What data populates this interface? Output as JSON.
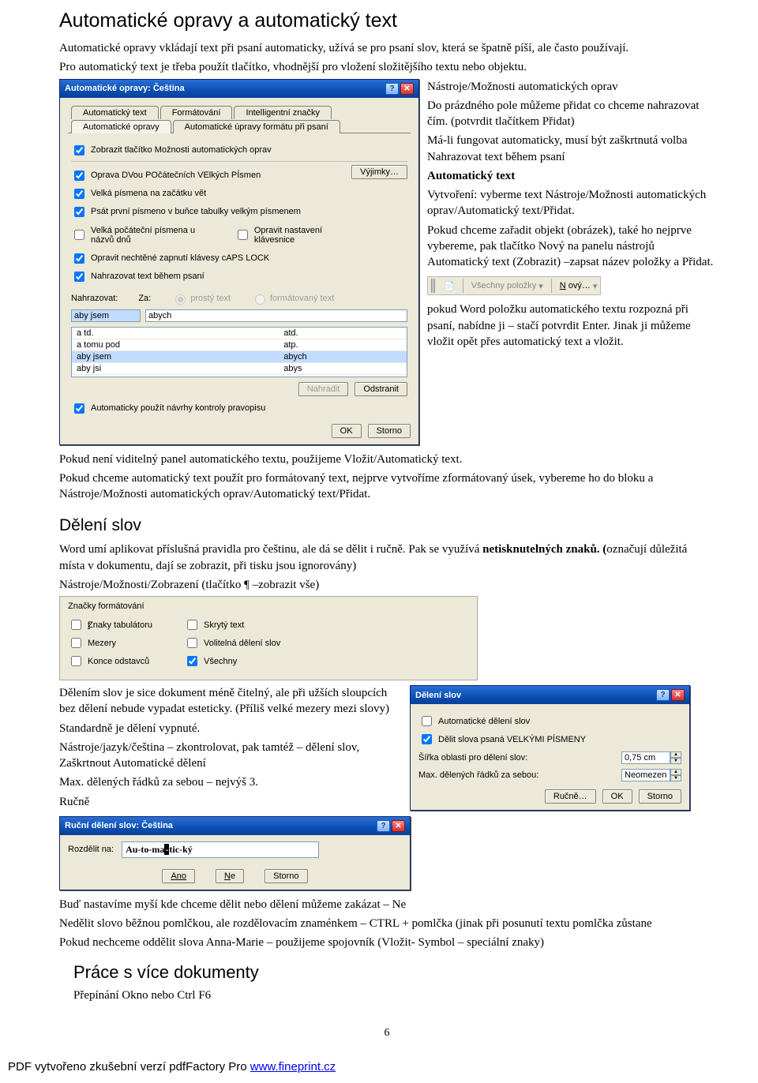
{
  "h1": "Automatické opravy a automatický text",
  "intro1": "Automatické opravy vkládají text při psaní automaticky, užívá se pro psaní slov, která se špatně píší, ale často používají.",
  "intro2": "Pro automatický text je třeba použít tlačítko, vhodnější pro vložení složitějšího textu nebo objektu.",
  "dlg1": {
    "title": "Automatické opravy: Čeština",
    "tabs": [
      "Automatický text",
      "Formátování",
      "Intelligentní značky",
      "Automatické opravy",
      "Automatické úpravy formátu při psaní"
    ],
    "chk_top": "Zobrazit tlačítko Možnosti automatických oprav",
    "opts": [
      "Oprava DVou POčátečních VElkých PÍsmen",
      "Velká písmena na začátku vět",
      "Psát první písmeno v buňce tabulky velkým písmenem",
      "Velká počáteční písmena u názvů dnů",
      "Opravit nastavení klávesnice",
      "Opravit nechtěné zapnutí klávesy cAPS LOCK",
      "Nahrazovat text během psaní"
    ],
    "opt_checked": [
      true,
      true,
      true,
      false,
      false,
      true,
      true
    ],
    "btn_exc": "Výjimky…",
    "lbl_nahr": "Nahrazovat:",
    "lbl_za": "Za:",
    "radio1": "prostý text",
    "radio2": "formátovaný text",
    "in1": "aby jsem",
    "in2": "abych",
    "rows": [
      [
        "a td.",
        "atd."
      ],
      [
        "a tomu pod",
        "atp."
      ],
      [
        "aby jsem",
        "abych"
      ],
      [
        "aby jsi",
        "abys"
      ]
    ],
    "btn_replace": "Nahradit",
    "btn_del": "Odstranit",
    "chk_bottom": "Automaticky použít návrhy kontroly pravopisu",
    "ok": "OK",
    "cancel": "Storno"
  },
  "right_block": {
    "p1": "Nástroje/Možnosti automatických oprav",
    "p2": "Do prázdného pole můžeme přidat co chceme nahrazovat čím. (potvrdit tlačítkem Přidat)",
    "p3": "Má-li fungovat automaticky, musí být zaškrtnutá volba Nahrazovat text během psaní",
    "p4h": "Automatický text",
    "p5": "Vytvoření: vyberme text Nástroje/Možnosti automatických oprav/Automatický text/Přidat.",
    "p6": "Pokud chceme zařadit objekt (obrázek), také ho nejprve vybereme, pak tlačítko Nový na panelu nástrojů Automatický text (Zobrazit) –zapsat název položky a Přidat."
  },
  "toolbar": {
    "all": "Všechny položky",
    "new": "Nový…"
  },
  "right2": {
    "p1": "pokud Word položku automatického textu rozpozná při psaní, nabídne ji – stačí potvrdit Enter. Jinak ji můžeme vložit opět přes automatický text a vložit."
  },
  "after_p1": "Pokud není viditelný panel automatického textu, použijeme  Vložit/Automatický text.",
  "after_p2": "Pokud chceme automatický text použít pro formátovaný text, nejprve vytvoříme zformátovaný úsek, vybereme ho do bloku a Nástroje/Možnosti automatických oprav/Automatický text/Přidat.",
  "h2_deleni": "Dělení slov",
  "deleni_p1a": "Word umí aplikovat příslušná pravidla pro češtinu, ale dá se dělit i ručně. Pak se využívá ",
  "deleni_p1b": "netisknutelných znaků. (",
  "deleni_p1c": "označují důležitá místa v dokumentu, dají se zobrazit, při tisku jsou ignorovány)",
  "deleni_p2": "Nástroje/Možnosti/Zobrazení  (tlačítko ¶ –zobrazit vše)",
  "panel": {
    "title": "Značky formátování",
    "left": [
      "Znaky tabulátoru",
      "Mezery",
      "Konce odstavců"
    ],
    "right": [
      "Skrytý text",
      "Volitelná dělení slov",
      "Všechny"
    ]
  },
  "below_p": [
    "Dělením slov je sice dokument méně čitelný, ale při užších sloupcích bez dělení nebude vypadat esteticky. (Příliš velké mezery mezi slovy)",
    "Standardně je dělení vypnuté.",
    "Nástroje/jazyk/čeština – zkontrolovat, pak tamtéž – dělení slov, Zaškrtnout Automatické dělení",
    "Max. dělených řádků za sebou – nejvýš 3.",
    "Ručně"
  ],
  "dlg_hyph": {
    "title": "Dělení slov",
    "chk1": "Automatické dělení slov",
    "chk2": "Dělit slova psaná VELKÝMI PÍSMENY",
    "l1": "Šířka oblasti pro dělení slov:",
    "v1": "0,75 cm",
    "l2": "Max. dělených řádků za sebou:",
    "v2": "Neomezeno",
    "b1": "Ručně…",
    "ok": "OK",
    "cancel": "Storno"
  },
  "dlg_manual": {
    "title": "Ruční dělení slov: Čeština",
    "label": "Rozdělit na:",
    "value": "Au-to-ma",
    "value2": "tic-ký",
    "yes": "Ano",
    "no": "Ne",
    "cancel": "Storno"
  },
  "end_p1": "Buď nastavíme myší kde chceme dělit nebo dělení můžeme zakázat – Ne",
  "end_p2": "Nedělit slovo běžnou pomlčkou, ale rozdělovacím znaménkem – CTRL + pomlčka (jinak při posunutí textu pomlčka zůstane",
  "end_p3": "Pokud nechceme oddělit slova Anna-Marie – použijeme spojovník  (Vložit- Symbol – speciální znaky)",
  "h2_prace": "Práce s více dokumenty",
  "prace_p": "Přepínání Okno nebo Ctrl F6",
  "page_no": "6",
  "footer_txt": "PDF vytvořeno zkušební verzí pdfFactory Pro ",
  "footer_link": "www.fineprint.cz"
}
